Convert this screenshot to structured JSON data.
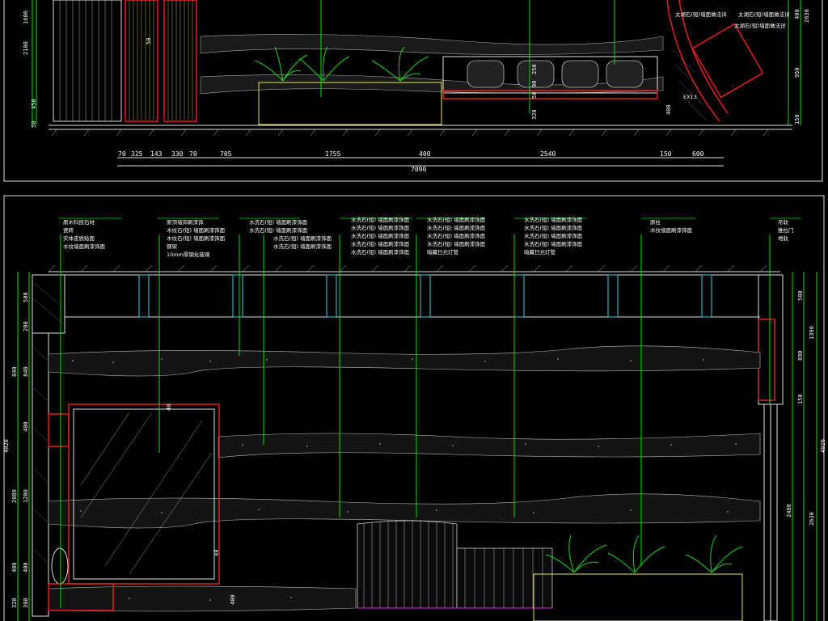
{
  "top_elevation": {
    "bottom_dims": [
      "70",
      "325",
      "143",
      "330",
      "70",
      "705",
      "1755",
      "400",
      "2540",
      "150",
      "600"
    ],
    "total_dim": "7090",
    "left_dims": [
      "1600",
      "2100",
      "450",
      "50"
    ],
    "right_dims": [
      "400",
      "2630",
      "950",
      "150"
    ],
    "interior_dims": [
      "50",
      "250",
      "90",
      "50",
      "320",
      "400"
    ],
    "callouts": [
      "太湖石(短)墙面做法详",
      "太湖石(短)墙面做法详",
      "太湖石(短)墙面做法详"
    ],
    "tag": "EX13"
  },
  "bottom_elevation": {
    "callouts": [
      {
        "lines": [
          "原木科技石材",
          "瓷砖",
          "实体皮质贴面",
          "木纹墙面刷漆饰面"
        ]
      },
      {
        "lines": [
          "原顶墙饰刷漆饰",
          "木纹石(短) 墙面刷漆饰面",
          "木纹石(短) 墙面刷漆饰面",
          "钢架",
          "10mm厚钢化玻璃"
        ]
      },
      {
        "lines": [
          "水洗石(短) 墙面刷漆饰面",
          "水洗石(短) 墙面刷漆饰面",
          "水洗石(短) 墙面刷漆饰面",
          "水洗石(短) 墙面刷漆饰面"
        ]
      },
      {
        "lines": [
          "水洗石(短) 墙面刷漆饰面",
          "水洗石(短) 墙面刷漆饰面",
          "水洗石(短) 墙面刷漆饰面",
          "水洗石(短) 墙面刷漆饰面",
          "水洗石(短) 墙面刷漆饰面"
        ]
      },
      {
        "lines": [
          "水洗石(短) 墙面刷漆饰面",
          "水洗石(短) 墙面刷漆饰面",
          "水洗石(短) 墙面刷漆饰面",
          "水洗石(短) 墙面刷漆饰面",
          "暗藏日光灯管"
        ]
      },
      {
        "lines": [
          "水洗石(短) 墙面刷漆饰面",
          "水洗石(短) 墙面刷漆饰面",
          "水洗石(短) 墙面刷漆饰面",
          "水洗石(短) 墙面刷漆饰面",
          "暗藏日光灯管"
        ]
      },
      {
        "lines": [
          "原柱",
          "木纹墙面刷漆饰面"
        ]
      },
      {
        "lines": [
          "吊轨",
          "推拉门",
          "地轨"
        ]
      }
    ],
    "left_dims_outer": [
      "4020"
    ],
    "left_dims_mid": [
      "500",
      "200",
      "840",
      "2080",
      "400",
      "320"
    ],
    "left_dims_inner": [
      "840",
      "400",
      "1200",
      "400",
      "300"
    ],
    "right_dims_outer": [
      "4020"
    ],
    "right_dims_mid": [
      "1390",
      "2630"
    ],
    "right_dims_inner": [
      "500",
      "890",
      "150",
      "2480"
    ],
    "interior_labels": [
      "40",
      "40",
      "400"
    ]
  }
}
